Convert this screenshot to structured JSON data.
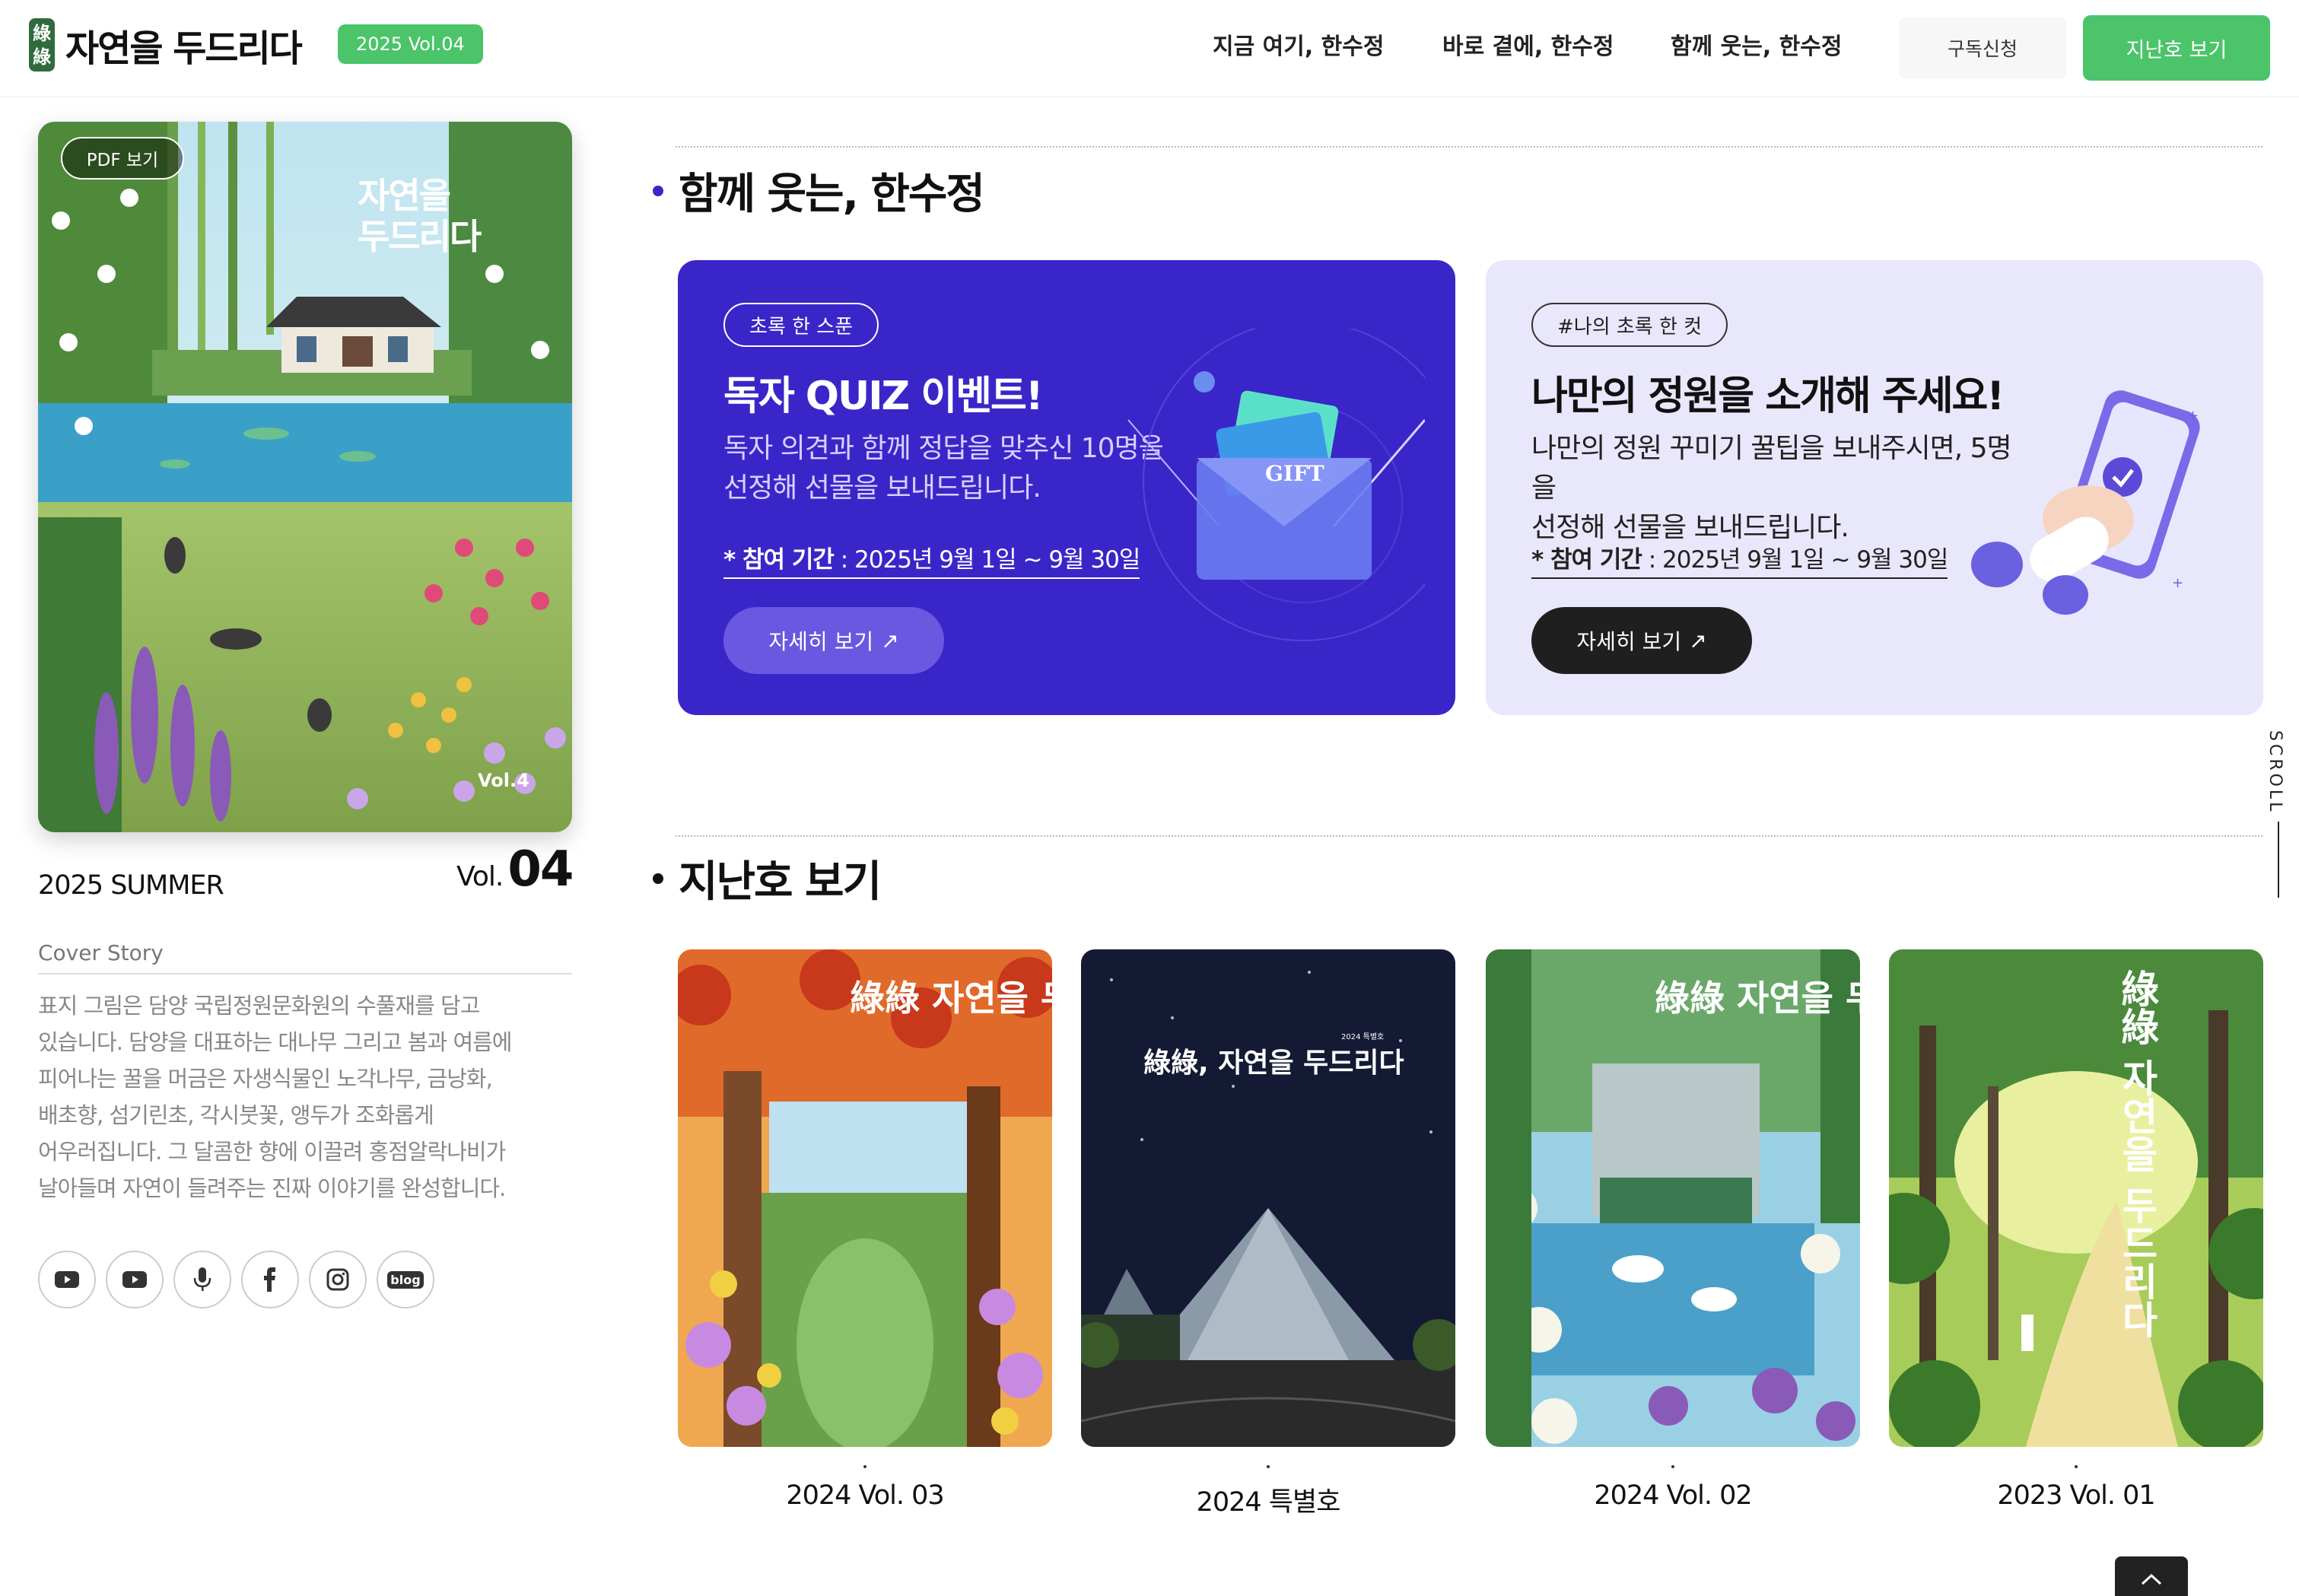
{
  "header": {
    "logo_mark": [
      "綠",
      "綠"
    ],
    "logo_text": "자연을 두드리다",
    "issue_badge": "2025 Vol.04",
    "nav": [
      "지금 여기, 한수정",
      "바로 곁에, 한수정",
      "함께 웃는, 한수정"
    ],
    "subscribe_label": "구독신청",
    "back_issues_label": "지난호 보기"
  },
  "cover": {
    "pdf_label": "PDF 보기",
    "title_line1": "자연을",
    "title_line2": "두드리다",
    "vol_mark": "Vol.4",
    "season": "2025 SUMMER",
    "vol_label": "Vol.",
    "vol_number": "04",
    "story_heading": "Cover Story",
    "story_lines": [
      "표지 그림은 담양 국립정원문화원의 수풀재를 담고",
      "있습니다. 담양을 대표하는 대나무 그리고 봄과 여름에",
      "피어나는 꿀을 머금은 자생식물인 노각나무, 금낭화,",
      "배초향, 섬기린초, 각시붓꽃, 앵두가 조화롭게",
      "어우러집니다. 그 달콤한 향에 이끌려 홍점알락나비가",
      "날아들며 자연이 들려주는 진짜 이야기를 완성합니다."
    ]
  },
  "social": {
    "icons": [
      "youtube-icon",
      "youtube-alt-icon",
      "podcast-mic-icon",
      "facebook-icon",
      "instagram-icon",
      "blog-icon"
    ],
    "blog_text": "blog"
  },
  "events": {
    "section_title": "함께 웃는, 한수정",
    "accent": "#3a26c8",
    "cards": [
      {
        "tag": "초록 한 스푼",
        "title": "독자 QUIZ 이벤트!",
        "desc_line1": "독자 의견과 함께 정답을 맞추신 10명을",
        "desc_line2": "선정해 선물을 보내드립니다.",
        "period_label": "* 참여 기간",
        "period_value": " : 2025년 9월 1일 ~ 9월 30일",
        "more_label": "자세히 보기",
        "gift_text": "GIFT"
      },
      {
        "tag": "#나의 초록 한 컷",
        "title": "나만의 정원을 소개해 주세요!",
        "desc_line1": "나만의 정원 꾸미기 꿀팁을 보내주시면, 5명을",
        "desc_line2": "선정해 선물을 보내드립니다.",
        "period_label": "* 참여 기간",
        "period_value": " : 2025년 9월 1일 ~ 9월 30일",
        "more_label": "자세히 보기"
      }
    ]
  },
  "archive": {
    "section_title": "지난호 보기",
    "issues": [
      {
        "label": "2024 Vol. 03",
        "cover_title": "綠綠 자연을 두드리다",
        "theme": "autumn"
      },
      {
        "label": "2024 특별호",
        "cover_title": "綠綠, 자연을 두드리다",
        "cover_subtitle": "2024 특별호",
        "theme": "night"
      },
      {
        "label": "2024 Vol. 02",
        "cover_title": "綠綠 자연을 두드리다",
        "theme": "lake"
      },
      {
        "label": "2023 Vol. 01",
        "cover_title": "綠綠 자연을 두드리다",
        "theme": "forest"
      }
    ]
  },
  "scroll_label": "SCROLL",
  "colors": {
    "green": "#4bc46a",
    "purple": "#3a26c8",
    "lilac": "#e9e7fb"
  }
}
